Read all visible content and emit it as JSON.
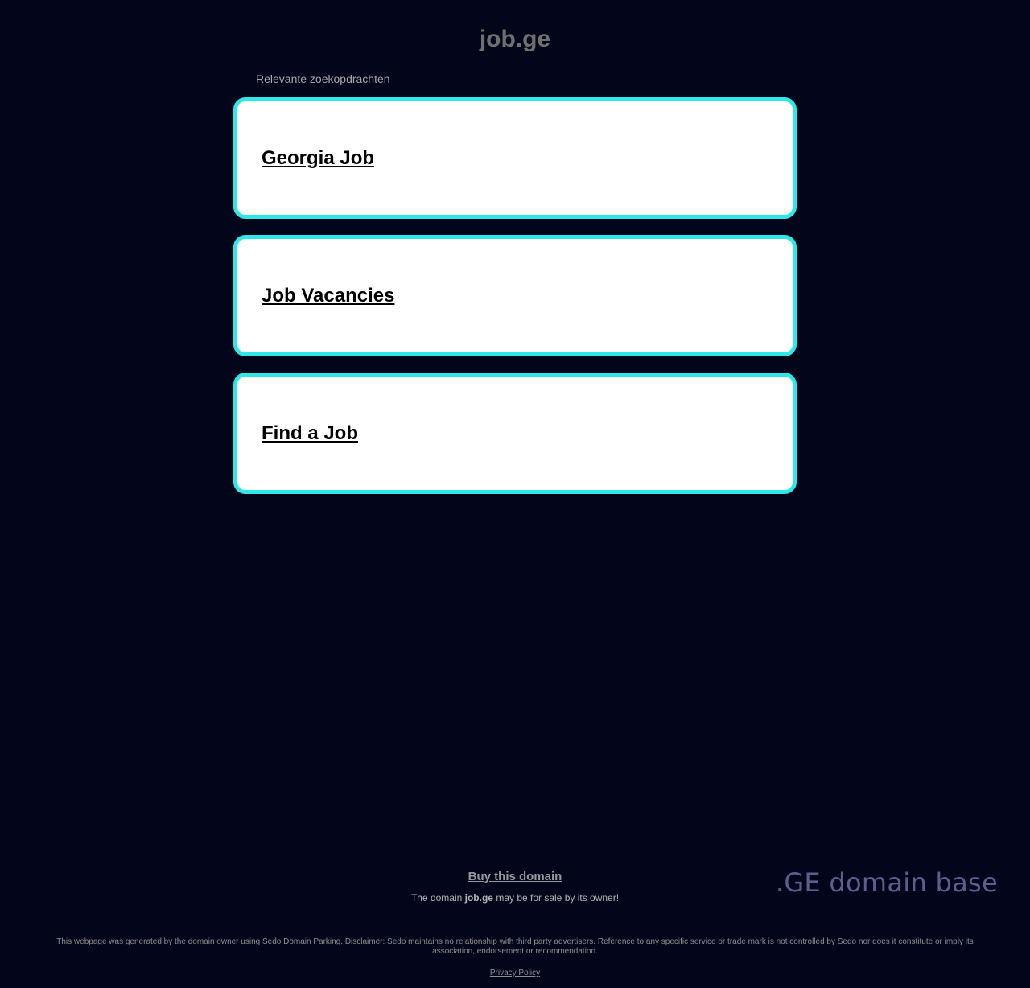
{
  "header": {
    "domain": "job.ge"
  },
  "related": {
    "label": "Relevante zoekopdrachten",
    "links": [
      {
        "label": "Georgia Job"
      },
      {
        "label": "Job Vacancies"
      },
      {
        "label": "Find a Job"
      }
    ]
  },
  "sale": {
    "buy_label": "Buy this domain",
    "text_before": "The domain ",
    "domain": "job.ge",
    "text_after": " may be for sale by its owner!"
  },
  "logo": {
    "text": ".GE domain base"
  },
  "footer": {
    "text_before": "This webpage was generated by the domain owner using ",
    "link_label": "Sedo Domain Parking",
    "text_after": ". Disclaimer: Sedo maintains no relationship with third party advertisers. Reference to any specific service or trade mark is not controlled by Sedo nor does it constitute or imply its association, endorsement or recommendation.",
    "privacy_label": "Privacy Policy"
  },
  "colors": {
    "background": "#03061a",
    "card_border": "#2ee8e8"
  }
}
